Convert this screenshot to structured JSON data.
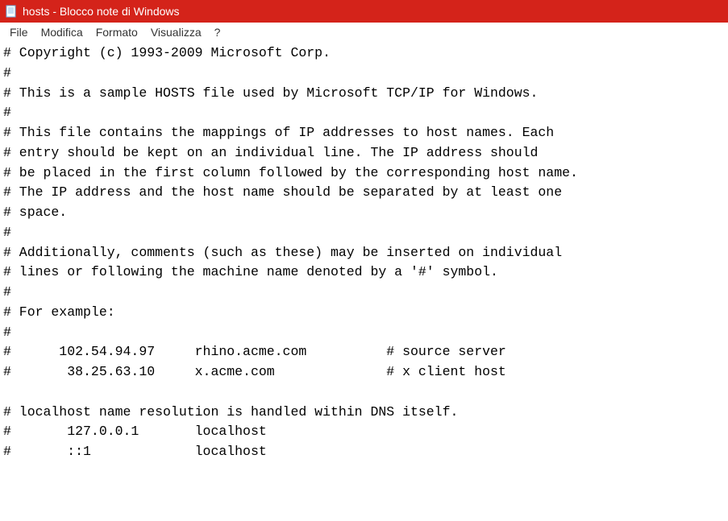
{
  "titlebar": {
    "title": "hosts - Blocco note di Windows"
  },
  "menu": {
    "file": "File",
    "edit": "Modifica",
    "format": "Formato",
    "view": "Visualizza",
    "help": "?"
  },
  "editor": {
    "content": "# Copyright (c) 1993-2009 Microsoft Corp.\n#\n# This is a sample HOSTS file used by Microsoft TCP/IP for Windows.\n#\n# This file contains the mappings of IP addresses to host names. Each\n# entry should be kept on an individual line. The IP address should\n# be placed in the first column followed by the corresponding host name.\n# The IP address and the host name should be separated by at least one\n# space.\n#\n# Additionally, comments (such as these) may be inserted on individual\n# lines or following the machine name denoted by a '#' symbol.\n#\n# For example:\n#\n#      102.54.94.97     rhino.acme.com          # source server\n#       38.25.63.10     x.acme.com              # x client host\n\n# localhost name resolution is handled within DNS itself.\n#       127.0.0.1       localhost\n#       ::1             localhost"
  }
}
